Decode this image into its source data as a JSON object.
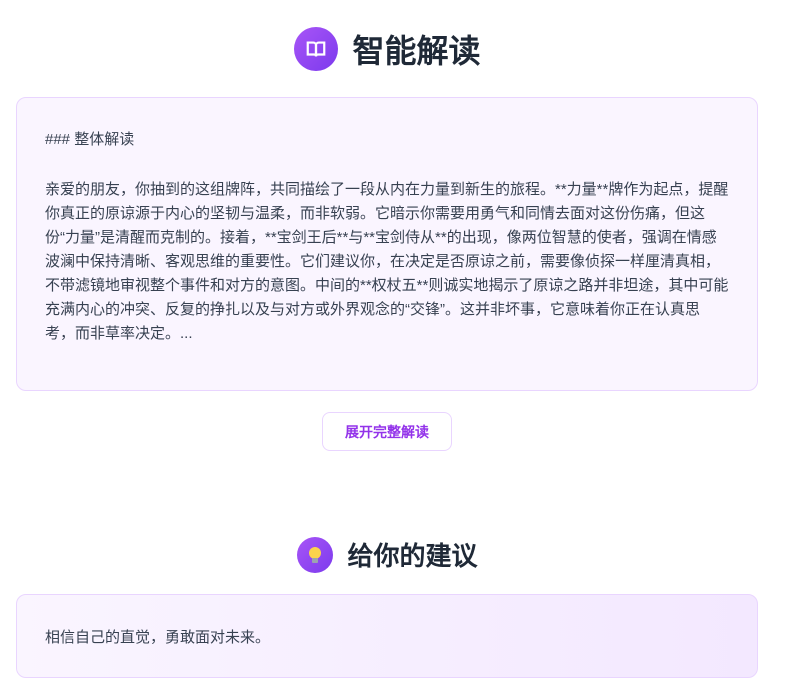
{
  "interpretation": {
    "title": "智能解读",
    "icon": "book-icon",
    "heading": "### 整体解读",
    "body": "亲爱的朋友，你抽到的这组牌阵，共同描绘了一段从内在力量到新生的旅程。**力量**牌作为起点，提醒你真正的原谅源于内心的坚韧与温柔，而非软弱。它暗示你需要用勇气和同情去面对这份伤痛，但这份“力量”是清醒而克制的。接着，**宝剑王后**与**宝剑侍从**的出现，像两位智慧的使者，强调在情感波澜中保持清晰、客观思维的重要性。它们建议你，在决定是否原谅之前，需要像侦探一样厘清真相，不带滤镜地审视整个事件和对方的意图。中间的**权杖五**则诚实地揭示了原谅之路并非坦途，其中可能充满内心的冲突、反复的挣扎以及与对方或外界观念的“交锋”。这并非坏事，它意味着你正在认真思考，而非草率决定。...",
    "expand_label": "展开完整解读"
  },
  "advice": {
    "title": "给你的建议",
    "icon": "lightbulb-icon",
    "text": "相信自己的直觉，勇敢面对未来。"
  },
  "colors": {
    "accent": "#9333ea",
    "border": "#e9d5ff",
    "card_bg": "#faf5ff"
  }
}
